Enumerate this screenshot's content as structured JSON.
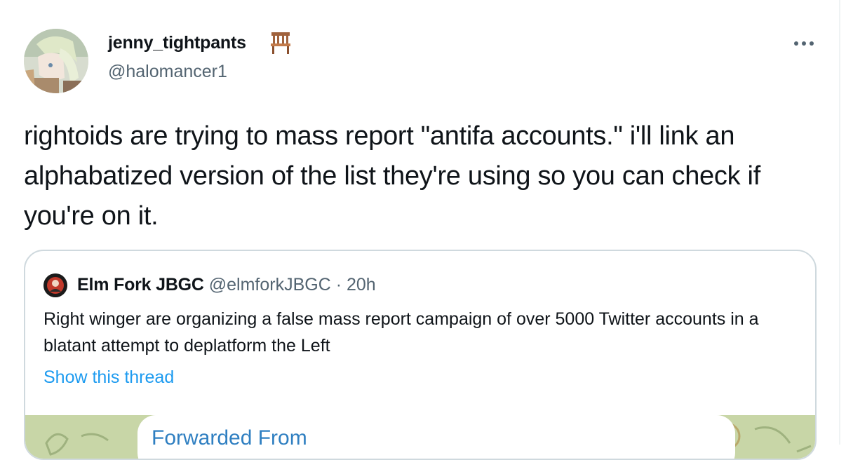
{
  "tweet": {
    "author_name": "jenny_tightpants",
    "author_handle": "@halomancer1",
    "text": "rightoids are trying to mass report \"antifa accounts.\" i'll link an alphabatized version of the list they're using so you can check if you're on it."
  },
  "quoted_tweet": {
    "author_name": "Elm Fork JBGC",
    "author_handle": "@elmforkJBGC",
    "separator": "·",
    "time": "20h",
    "text": "Right winger are organizing a false mass report campaign of over 5000 Twitter accounts in a blatant attempt to deplatform the Left",
    "show_thread_label": "Show this thread",
    "media": {
      "forwarded_label": "Forwarded From"
    }
  },
  "icons": {
    "more": "more-horizontal-icon",
    "name_emoji": "chair-icon"
  },
  "colors": {
    "text_primary": "#0f1419",
    "text_secondary": "#536471",
    "link": "#1d9bf0",
    "border": "#cfd9de",
    "media_background": "#c8d6a7",
    "forwarded_text": "#2f7fc1"
  }
}
